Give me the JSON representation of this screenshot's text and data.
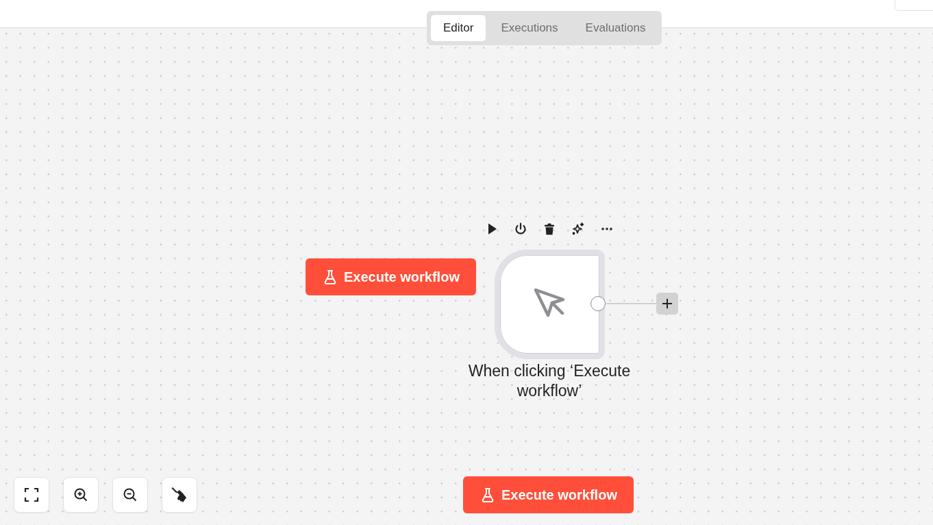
{
  "tabs": [
    {
      "label": "Editor",
      "selected": true
    },
    {
      "label": "Executions",
      "selected": false
    },
    {
      "label": "Evaluations",
      "selected": false
    }
  ],
  "node": {
    "label": "When clicking ‘Execute workflow’"
  },
  "node_button": {
    "label": "Execute workflow"
  },
  "canvas_button": {
    "label": "Execute workflow"
  }
}
